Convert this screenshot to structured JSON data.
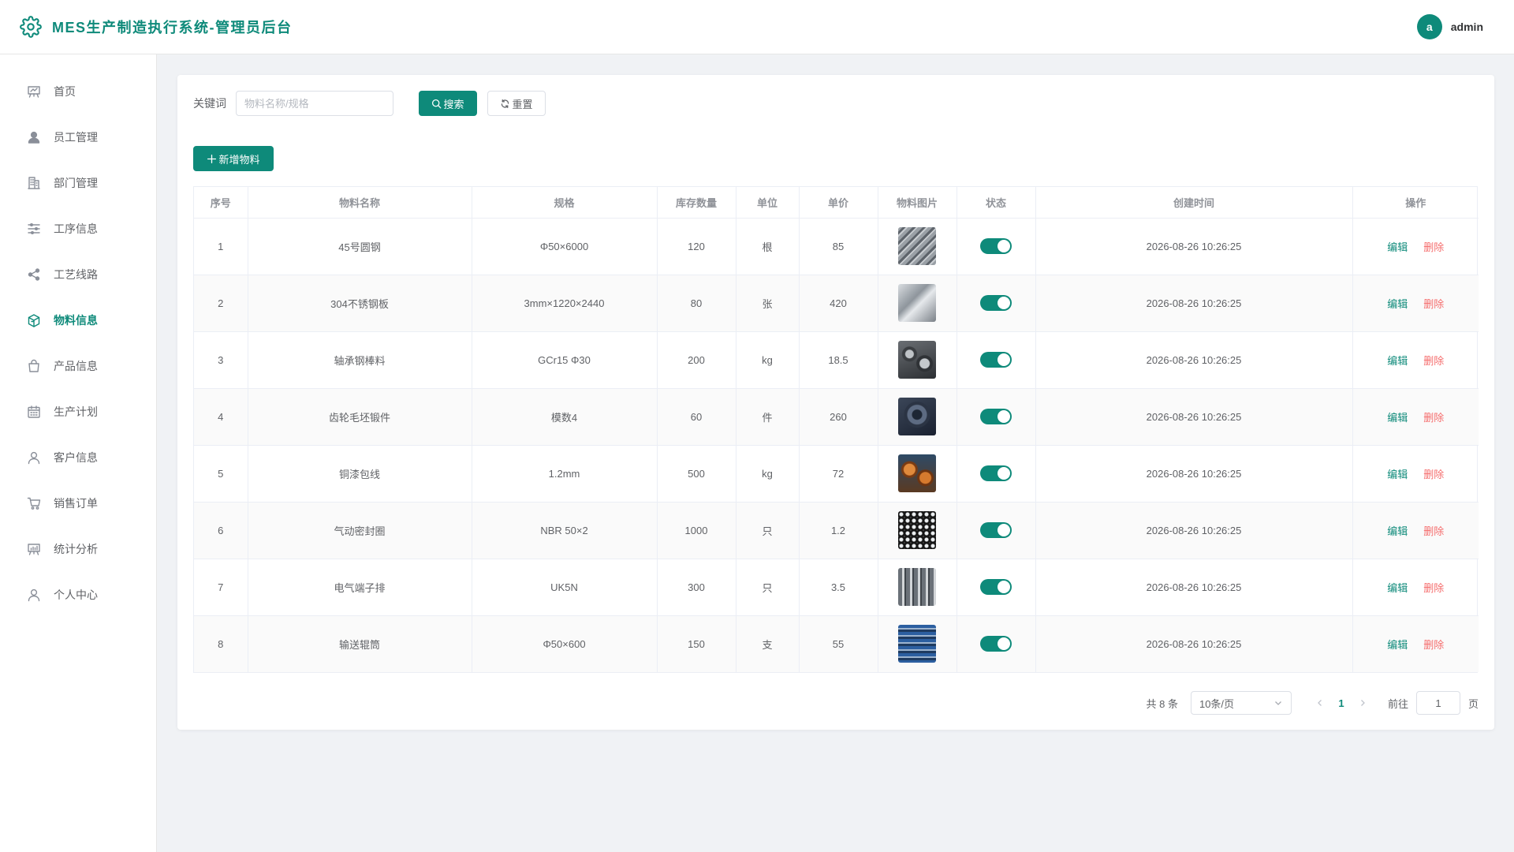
{
  "app": {
    "title": "MES生产制造执行系统-管理员后台"
  },
  "user": {
    "initial": "a",
    "name": "admin"
  },
  "sidebar": {
    "items": [
      {
        "label": "首页",
        "icon": "dashboard-icon",
        "active": false
      },
      {
        "label": "员工管理",
        "icon": "user-filled-icon",
        "active": false
      },
      {
        "label": "部门管理",
        "icon": "office-building-icon",
        "active": false
      },
      {
        "label": "工序信息",
        "icon": "operation-icon",
        "active": false
      },
      {
        "label": "工艺线路",
        "icon": "share-icon",
        "active": false
      },
      {
        "label": "物料信息",
        "icon": "box-icon",
        "active": true
      },
      {
        "label": "产品信息",
        "icon": "shopping-bag-icon",
        "active": false
      },
      {
        "label": "生产计划",
        "icon": "calendar-icon",
        "active": false
      },
      {
        "label": "客户信息",
        "icon": "user-icon",
        "active": false
      },
      {
        "label": "销售订单",
        "icon": "shopping-cart-icon",
        "active": false
      },
      {
        "label": "统计分析",
        "icon": "data-analysis-icon",
        "active": false
      },
      {
        "label": "个人中心",
        "icon": "user-icon",
        "active": false
      }
    ]
  },
  "search": {
    "label": "关键词",
    "placeholder": "物料名称/规格",
    "value": "",
    "search_label": "搜索",
    "reset_label": "重置"
  },
  "toolbar": {
    "add_label": "新增物料"
  },
  "table": {
    "headers": [
      "序号",
      "物料名称",
      "规格",
      "库存数量",
      "单位",
      "单价",
      "物料图片",
      "状态",
      "创建时间",
      "操作"
    ],
    "edit_label": "编辑",
    "delete_label": "删除",
    "rows": [
      {
        "id": "1",
        "name": "45号圆钢",
        "spec": "Φ50×6000",
        "qty": "120",
        "unit": "根",
        "price": "85",
        "thumb": "steel-bars",
        "enabled": true,
        "created": "2026-08-26 10:26:25"
      },
      {
        "id": "2",
        "name": "304不锈钢板",
        "spec": "3mm×1220×2440",
        "qty": "80",
        "unit": "张",
        "price": "420",
        "thumb": "steel-plate",
        "enabled": true,
        "created": "2026-08-26 10:26:25"
      },
      {
        "id": "3",
        "name": "轴承钢棒料",
        "spec": "GCr15 Φ30",
        "qty": "200",
        "unit": "kg",
        "price": "18.5",
        "thumb": "bearing-bar",
        "enabled": true,
        "created": "2026-08-26 10:26:25"
      },
      {
        "id": "4",
        "name": "齿轮毛坯锻件",
        "spec": "模数4",
        "qty": "60",
        "unit": "件",
        "price": "260",
        "thumb": "gear-blank",
        "enabled": true,
        "created": "2026-08-26 10:26:25"
      },
      {
        "id": "5",
        "name": "铜漆包线",
        "spec": "1.2mm",
        "qty": "500",
        "unit": "kg",
        "price": "72",
        "thumb": "copper-wire",
        "enabled": true,
        "created": "2026-08-26 10:26:25"
      },
      {
        "id": "6",
        "name": "气动密封圈",
        "spec": "NBR 50×2",
        "qty": "1000",
        "unit": "只",
        "price": "1.2",
        "thumb": "seal-rings",
        "enabled": true,
        "created": "2026-08-26 10:26:25"
      },
      {
        "id": "7",
        "name": "电气端子排",
        "spec": "UK5N",
        "qty": "300",
        "unit": "只",
        "price": "3.5",
        "thumb": "terminal-block",
        "enabled": true,
        "created": "2026-08-26 10:26:25"
      },
      {
        "id": "8",
        "name": "输送辊筒",
        "spec": "Φ50×600",
        "qty": "150",
        "unit": "支",
        "price": "55",
        "thumb": "conveyor-rollers",
        "enabled": true,
        "created": "2026-08-26 10:26:25"
      }
    ]
  },
  "pagination": {
    "total_label": "共 8 条",
    "page_size": "10条/页",
    "current_page": "1",
    "goto_label": "前往",
    "goto_value": "1",
    "page_suffix": "页"
  },
  "colors": {
    "primary": "#0e8a7a",
    "danger": "#f56c6c",
    "page_bg": "#f0f2f5"
  }
}
